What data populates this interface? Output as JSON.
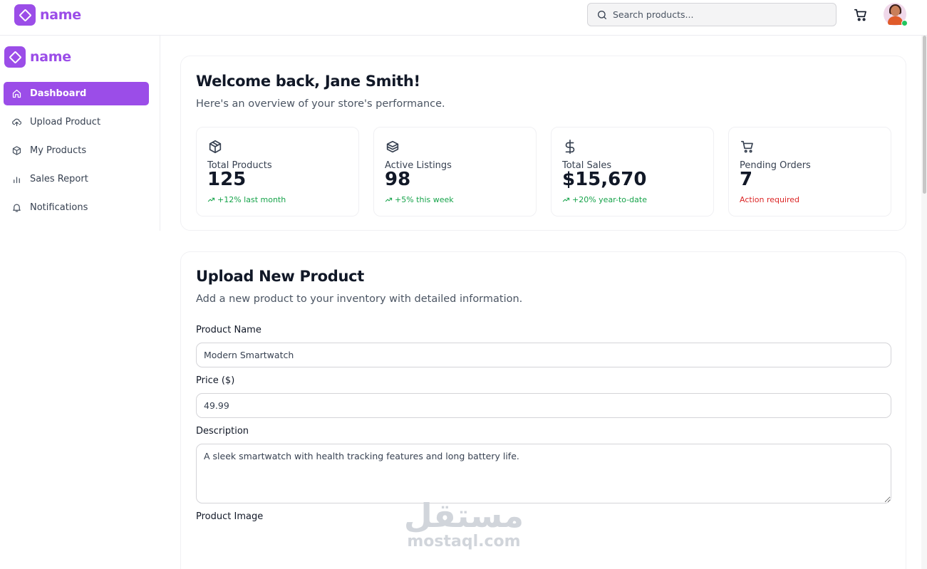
{
  "brand": {
    "name": "name",
    "color": "#9b4de8"
  },
  "header": {
    "search_placeholder": "Search products...",
    "icons": [
      "search-icon",
      "cart-icon",
      "avatar"
    ]
  },
  "sidebar": {
    "items": [
      {
        "label": "Dashboard",
        "icon": "home-icon",
        "active": true
      },
      {
        "label": "Upload Product",
        "icon": "upload-cloud-icon",
        "active": false
      },
      {
        "label": "My Products",
        "icon": "package-icon",
        "active": false
      },
      {
        "label": "Sales Report",
        "icon": "bar-chart-icon",
        "active": false
      },
      {
        "label": "Notifications",
        "icon": "bell-icon",
        "active": false
      }
    ]
  },
  "welcome": {
    "title": "Welcome back, Jane Smith!",
    "subtitle": "Here's an overview of your store's performance.",
    "stats": [
      {
        "label": "Total Products",
        "value": "125",
        "note": "+12% last month",
        "icon": "package-icon",
        "status": "positive"
      },
      {
        "label": "Active Listings",
        "value": "98",
        "note": "+5% this week",
        "icon": "boxes-icon",
        "status": "positive"
      },
      {
        "label": "Total Sales",
        "value": "$15,670",
        "note": "+20% year-to-date",
        "icon": "dollar-icon",
        "status": "positive"
      },
      {
        "label": "Pending Orders",
        "value": "7",
        "note": "Action required",
        "icon": "cart-icon",
        "status": "alert"
      }
    ]
  },
  "upload": {
    "title": "Upload New Product",
    "subtitle": "Add a new product to your inventory with detailed information.",
    "fields": {
      "name_label": "Product Name",
      "name_value": "Modern Smartwatch",
      "price_label": "Price ($)",
      "price_value": "49.99",
      "description_label": "Description",
      "description_value": "A sleek smartwatch with health tracking features and long battery life.",
      "image_label": "Product Image"
    }
  },
  "watermark": {
    "arabic": "مستقل",
    "latin": "mostaql.com"
  },
  "colors": {
    "accent": "#9b4de8",
    "positive": "#16a34a",
    "alert": "#dc2626"
  }
}
